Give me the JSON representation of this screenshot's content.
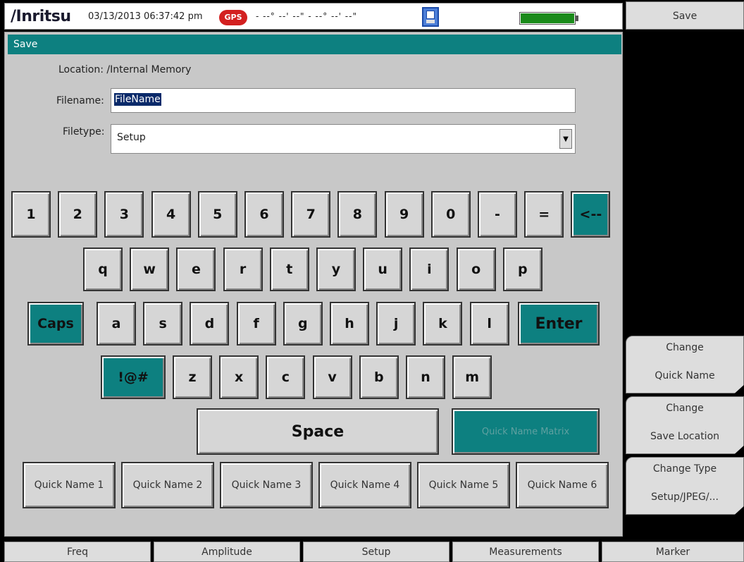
{
  "status_bar": {
    "logo": "/Inritsu",
    "datetime": "03/13/2013 06:37:42 pm",
    "gps_badge": "GPS",
    "coordinates": "- --° --' --\" - --° --' --\"",
    "icons": [
      "disk-icon",
      "battery-icon"
    ],
    "battery_level": 1.0,
    "battery_color": "#1a8a1a"
  },
  "dialog": {
    "title": "Save",
    "location_text": "Location: /Internal Memory",
    "filename_label": "Filename:",
    "filename_value": "FileName",
    "filetype_label": "Filetype:",
    "filetype_value": "Setup",
    "accent_color": "#0d8080"
  },
  "keyboard": {
    "row1": [
      "1",
      "2",
      "3",
      "4",
      "5",
      "6",
      "7",
      "8",
      "9",
      "0",
      "-",
      "=",
      "<--"
    ],
    "row2": [
      "q",
      "w",
      "e",
      "r",
      "t",
      "y",
      "u",
      "i",
      "o",
      "p"
    ],
    "row3": [
      "Caps",
      "a",
      "s",
      "d",
      "f",
      "g",
      "h",
      "j",
      "k",
      "l",
      "Enter"
    ],
    "row4": [
      "!@#",
      "z",
      "x",
      "c",
      "v",
      "b",
      "n",
      "m"
    ],
    "space": "Space",
    "quick_name_matrix": "Quick Name Matrix",
    "quick_names": [
      "Quick Name 1",
      "Quick Name 2",
      "Quick Name 3",
      "Quick Name 4",
      "Quick Name 5",
      "Quick Name 6"
    ]
  },
  "side_menu": {
    "title": "Save",
    "items": [
      {
        "line1": "Change",
        "line2": "Quick Name"
      },
      {
        "line1": "Change",
        "line2": "Save Location"
      },
      {
        "line1": "Change Type",
        "line2": "Setup/JPEG/..."
      }
    ]
  },
  "bottom_menu": [
    "Freq",
    "Amplitude",
    "Setup",
    "Measurements",
    "Marker"
  ]
}
